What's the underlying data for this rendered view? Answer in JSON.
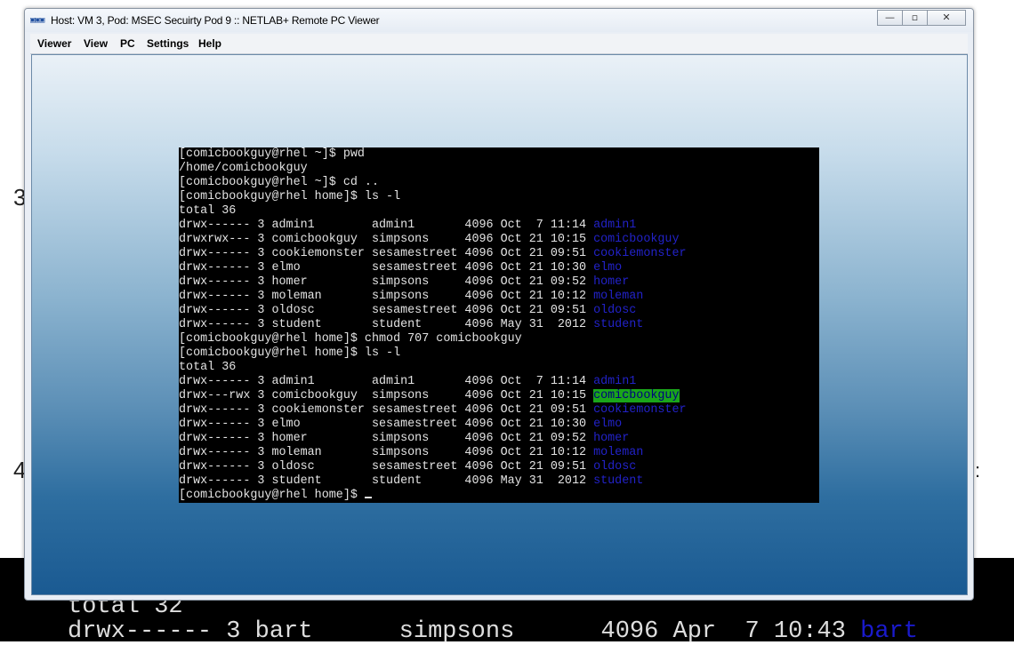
{
  "background": {
    "left_char_1": "3",
    "left_char_2": "4",
    "right_char": ":",
    "terminal_line_1": "total 32",
    "terminal_line_2_prefix": "drwx------ 3 bart      simpsons      4096 Apr  7 10:43 ",
    "terminal_line_2_name": "bart"
  },
  "window": {
    "title": "Host: VM 3, Pod: MSEC Secuirty Pod 9 :: NETLAB+ Remote PC Viewer",
    "app_icon": "remote-pc-icon",
    "buttons": {
      "minimize": "—",
      "restore": "▫",
      "close": "✕"
    }
  },
  "menu": [
    "Viewer",
    "View",
    "PC",
    "Settings",
    "Help"
  ],
  "terminal": {
    "lines": [
      {
        "text": "[comicbookguy@rhel ~]$ pwd"
      },
      {
        "text": "/home/comicbookguy"
      },
      {
        "text": "[comicbookguy@rhel ~]$ cd .."
      },
      {
        "text": "[comicbookguy@rhel home]$ ls -l"
      },
      {
        "text": "total 36"
      },
      {
        "text": "drwx------ 3 admin1        admin1       4096 Oct  7 11:14 ",
        "dir": "admin1"
      },
      {
        "text": "drwxrwx--- 3 comicbookguy  simpsons     4096 Oct 21 10:15 ",
        "dir": "comicbookguy"
      },
      {
        "text": "drwx------ 3 cookiemonster sesamestreet 4096 Oct 21 09:51 ",
        "dir": "cookiemonster"
      },
      {
        "text": "drwx------ 3 elmo          sesamestreet 4096 Oct 21 10:30 ",
        "dir": "elmo"
      },
      {
        "text": "drwx------ 3 homer         simpsons     4096 Oct 21 09:52 ",
        "dir": "homer"
      },
      {
        "text": "drwx------ 3 moleman       simpsons     4096 Oct 21 10:12 ",
        "dir": "moleman"
      },
      {
        "text": "drwx------ 3 oldosc        sesamestreet 4096 Oct 21 09:51 ",
        "dir": "oldosc"
      },
      {
        "text": "drwx------ 3 student       student      4096 May 31  2012 ",
        "dir": "student"
      },
      {
        "text": "[comicbookguy@rhel home]$ chmod 707 comicbookguy"
      },
      {
        "text": "[comicbookguy@rhel home]$ ls -l"
      },
      {
        "text": "total 36"
      },
      {
        "text": "drwx------ 3 admin1        admin1       4096 Oct  7 11:14 ",
        "dir": "admin1"
      },
      {
        "text": "drwx---rwx 3 comicbookguy  simpsons     4096 Oct 21 10:15 ",
        "dir": "comicbookguy",
        "highlight": true
      },
      {
        "text": "drwx------ 3 cookiemonster sesamestreet 4096 Oct 21 09:51 ",
        "dir": "cookiemonster"
      },
      {
        "text": "drwx------ 3 elmo          sesamestreet 4096 Oct 21 10:30 ",
        "dir": "elmo"
      },
      {
        "text": "drwx------ 3 homer         simpsons     4096 Oct 21 09:52 ",
        "dir": "homer"
      },
      {
        "text": "drwx------ 3 moleman       simpsons     4096 Oct 21 10:12 ",
        "dir": "moleman"
      },
      {
        "text": "drwx------ 3 oldosc        sesamestreet 4096 Oct 21 09:51 ",
        "dir": "oldosc"
      },
      {
        "text": "drwx------ 3 student       student      4096 May 31  2012 ",
        "dir": "student"
      },
      {
        "text": "[comicbookguy@rhel home]$ ",
        "cursor": true
      }
    ]
  }
}
